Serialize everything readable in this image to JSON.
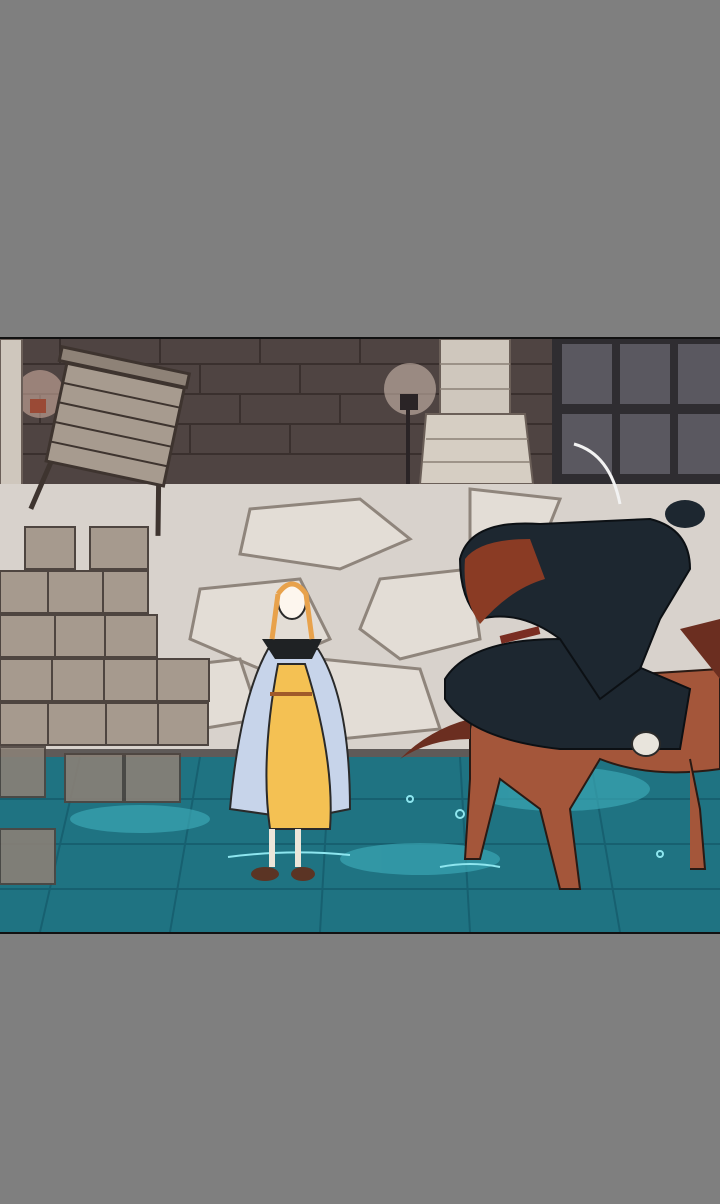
{
  "viewer": {
    "background_color": "#7f7f7f",
    "panel_count": 1
  },
  "panel": {
    "scene": "night-street-courtyard",
    "colors": {
      "wall_dark": "#4f4442",
      "wall_stone": "#d8d2cc",
      "water": "#1f7382",
      "water_light": "#3aa6b4",
      "crate": "#9d9287",
      "dress": "#f4c153",
      "cloak_light": "#c7d4ea",
      "rider_cloak": "#1d2730",
      "horse": "#a4563a"
    },
    "icons": [
      "cart-icon",
      "crate-stack-icon",
      "wall-lamp-icon",
      "figure-icon",
      "horse-rider-icon"
    ]
  }
}
